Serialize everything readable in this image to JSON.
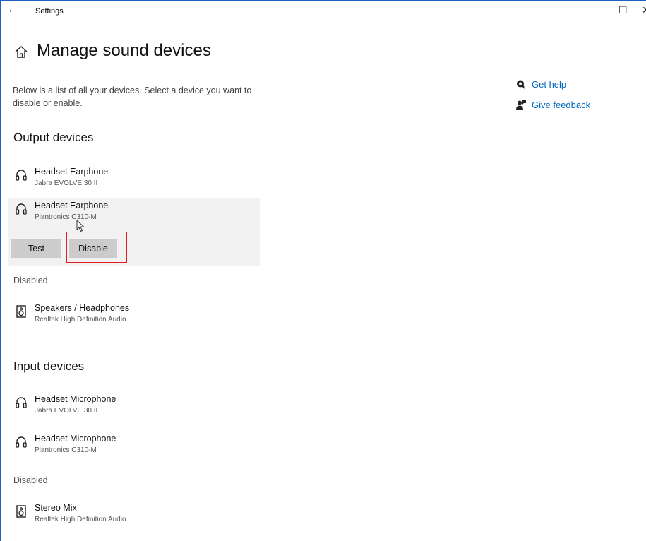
{
  "window": {
    "title": "Settings",
    "back_glyph": "←",
    "min_glyph": "–",
    "max_glyph": "☐",
    "close_glyph": "✕"
  },
  "page": {
    "title": "Manage sound devices",
    "description": "Below is a list of all your devices. Select a device you want to disable or enable."
  },
  "help": {
    "get_help": "Get help",
    "give_feedback": "Give feedback",
    "link_color": "#0067c0"
  },
  "output": {
    "heading": "Output devices",
    "devices": [
      {
        "name": "Headset Earphone",
        "sub": "Jabra EVOLVE 30 II",
        "icon": "headphones-icon"
      },
      {
        "name": "Headset Earphone",
        "sub": "Plantronics C310-M",
        "icon": "headphones-icon",
        "selected": true
      }
    ],
    "buttons": {
      "test": "Test",
      "disable": "Disable"
    },
    "disabled_label": "Disabled",
    "disabled_devices": [
      {
        "name": "Speakers / Headphones",
        "sub": "Realtek High Definition Audio",
        "icon": "speaker-icon"
      }
    ]
  },
  "input": {
    "heading": "Input devices",
    "devices": [
      {
        "name": "Headset Microphone",
        "sub": "Jabra EVOLVE 30 II",
        "icon": "headphones-icon"
      },
      {
        "name": "Headset Microphone",
        "sub": "Plantronics C310-M",
        "icon": "headphones-icon"
      }
    ],
    "disabled_label": "Disabled",
    "disabled_devices": [
      {
        "name": "Stereo Mix",
        "sub": "Realtek High Definition Audio",
        "icon": "speaker-icon"
      }
    ]
  },
  "colors": {
    "highlight_box": "#e31d1d",
    "selected_bg": "#f2f2f2",
    "button_bg": "#cccccc",
    "window_border": "#1e5fbf"
  }
}
